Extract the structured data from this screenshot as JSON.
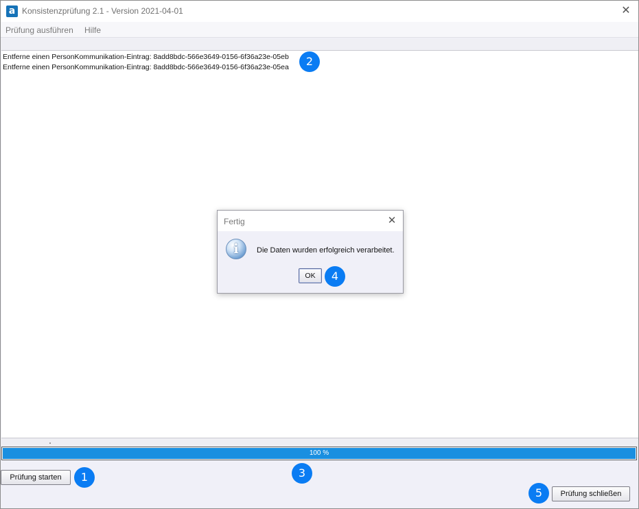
{
  "window": {
    "title": "Konsistenzprüfung 2.1 - Version 2021-04-01",
    "app_icon_letter": "a",
    "close_glyph": "✕"
  },
  "menu": {
    "items": [
      {
        "label": "Prüfung ausführen"
      },
      {
        "label": "Hilfe"
      }
    ]
  },
  "log": {
    "lines": [
      "Entferne einen PersonKommunikation-Eintrag: 8add8bdc-566e3649-0156-6f36a23e-05eb",
      "Entferne einen PersonKommunikation-Eintrag: 8add8bdc-566e3649-0156-6f36a23e-05ea"
    ]
  },
  "progress": {
    "value": 100,
    "label": "100 %",
    "fill_color": "#1a8fe0"
  },
  "buttons": {
    "start_label": "Prüfung starten",
    "close_label": "Prüfung schließen"
  },
  "dialog": {
    "title": "Fertig",
    "close_glyph": "✕",
    "icon": "info-icon",
    "icon_glyph": "i",
    "message": "Die Daten wurden erfolgreich verarbeitet.",
    "ok_label": "OK"
  },
  "markers": [
    "1",
    "2",
    "3",
    "4",
    "5"
  ],
  "colors": {
    "marker": "#0a7cf3",
    "app_icon": "#1673b8"
  }
}
